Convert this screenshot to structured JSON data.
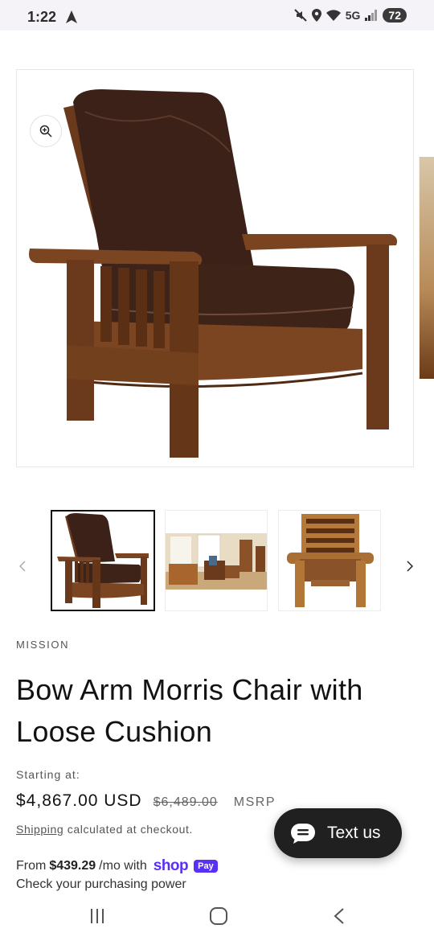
{
  "status_bar": {
    "time": "1:22",
    "network": "5G",
    "battery": "72"
  },
  "product": {
    "vendor": "MISSION",
    "title": "Bow Arm Morris Chair with Loose Cushion",
    "starting_label": "Starting at:",
    "price": "$4,867.00 USD",
    "compare_price": "$6,489.00",
    "msrp_label": "MSRP",
    "shipping_link": "Shipping",
    "shipping_text": "calculated at checkout.",
    "installment_prefix": "From",
    "installment_amount": "$439.29",
    "installment_suffix": "/mo with",
    "shop_logo": "shop",
    "shop_pay_badge": "Pay",
    "prequalify_text": "Check your purchasing power"
  },
  "chat": {
    "label": "Text us"
  },
  "colors": {
    "wood": "#6b3a1c",
    "leather": "#3b2118",
    "shop_pay": "#5a31f4",
    "chat_bg": "#202020"
  },
  "icons": {
    "zoom": "zoom-in-icon",
    "prev": "chevron-left-icon",
    "next": "chevron-right-icon",
    "chat": "chat-bubble-icon"
  }
}
